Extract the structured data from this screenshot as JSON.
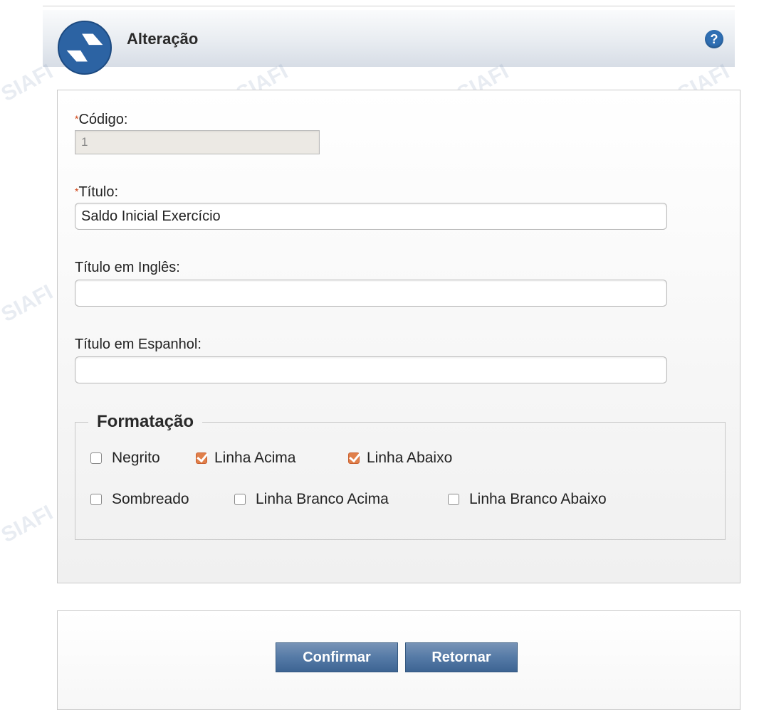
{
  "header": {
    "title": "Alteração",
    "help_icon": "help-icon",
    "logo_icon": "siafi-logo-icon"
  },
  "form": {
    "codigo_label": "Código:",
    "codigo_value": "1",
    "titulo_label": "Título:",
    "titulo_value": "Saldo Inicial Exercício",
    "titulo_ingles_label": "Título em Inglês:",
    "titulo_ingles_value": "",
    "titulo_espanhol_label": "Título em Espanhol:",
    "titulo_espanhol_value": "",
    "required_mark": "*"
  },
  "formatacao": {
    "legend": "Formatação",
    "options": [
      {
        "label": "Negrito",
        "checked": false
      },
      {
        "label": "Linha Acima",
        "checked": true
      },
      {
        "label": "Linha Abaixo",
        "checked": true
      },
      {
        "label": "Sombreado",
        "checked": false
      },
      {
        "label": "Linha Branco Acima",
        "checked": false
      },
      {
        "label": "Linha Branco Abaixo",
        "checked": false
      }
    ]
  },
  "buttons": {
    "confirm": "Confirmar",
    "back": "Retornar"
  },
  "watermark": "SIAFI",
  "colors": {
    "accent_checkbox": "#e07f4a",
    "button": "#557aa6",
    "required": "#d04010",
    "help": "#2f6fb3"
  }
}
